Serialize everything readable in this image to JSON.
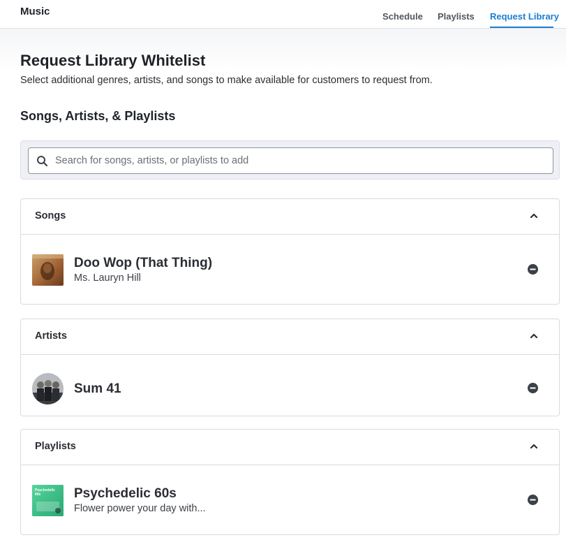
{
  "app": {
    "title": "Music"
  },
  "nav": {
    "items": [
      {
        "label": "Schedule"
      },
      {
        "label": "Playlists"
      },
      {
        "label": "Request Library"
      }
    ],
    "active": "Request Library"
  },
  "page": {
    "title": "Request Library Whitelist",
    "description": "Select additional genres, artists, and songs to make available for customers to request from.",
    "section_title": "Songs, Artists, & Playlists"
  },
  "search": {
    "placeholder": "Search for songs, artists, or playlists to add",
    "value": ""
  },
  "sections": [
    {
      "label": "Songs",
      "items": [
        {
          "title": "Doo Wop (That Thing)",
          "subtitle": "Ms. Lauryn Hill"
        }
      ]
    },
    {
      "label": "Artists",
      "items": [
        {
          "title": "Sum 41"
        }
      ]
    },
    {
      "label": "Playlists",
      "items": [
        {
          "title": "Psychedelic 60s",
          "subtitle": "Flower power your day with...",
          "cover_text": "Psychedelic 60s"
        }
      ]
    }
  ],
  "colors": {
    "accent": "#1a7fd1",
    "text": "#2a2d33",
    "border": "#d7dae0",
    "search_bg": "#eef0f5",
    "playlist_cover": "#3fbf8a"
  },
  "icons": {
    "search": "search-icon",
    "collapse": "chevron-up-icon",
    "remove": "remove-circle-icon"
  }
}
